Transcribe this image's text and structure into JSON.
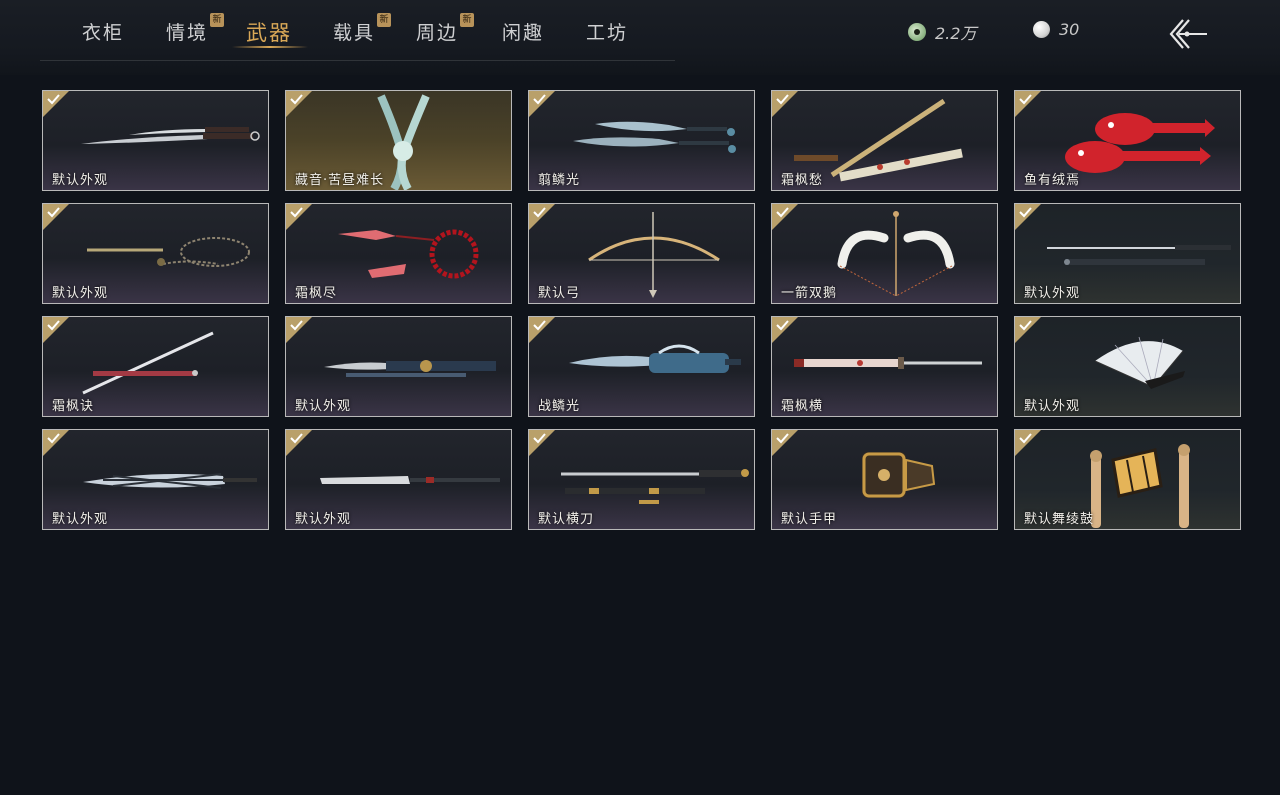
{
  "tabs": [
    {
      "label": "衣柜",
      "new": ""
    },
    {
      "label": "情境",
      "new": "新"
    },
    {
      "label": "武器",
      "new": ""
    },
    {
      "label": "载具",
      "new": "新"
    },
    {
      "label": "周边",
      "new": "新"
    },
    {
      "label": "闲趣",
      "new": ""
    },
    {
      "label": "工坊",
      "new": ""
    }
  ],
  "active_tab": "武器",
  "currency": {
    "jade_amount": "2.2万",
    "pearl_amount": "30"
  },
  "colors": {
    "accent": "#d9a857",
    "check_badge": "#b9a06a",
    "background": "#0f131a"
  },
  "items": [
    {
      "name": "默认外观",
      "icon": "twin-dao-blades"
    },
    {
      "name": "藏音·苦昼难长",
      "icon": "jade-flute-charm"
    },
    {
      "name": "翦鳞光",
      "icon": "twin-dragon-blades"
    },
    {
      "name": "霜枫愁",
      "icon": "flute-and-scabbard"
    },
    {
      "name": "鱼有绒焉",
      "icon": "red-fish-weapons"
    },
    {
      "name": "默认外观",
      "icon": "rope-dart"
    },
    {
      "name": "霜枫尽",
      "icon": "red-rope-dart-beads"
    },
    {
      "name": "默认弓",
      "icon": "bow"
    },
    {
      "name": "一箭双鹅",
      "icon": "white-bow"
    },
    {
      "name": "默认外观",
      "icon": "straight-sword-pair"
    },
    {
      "name": "霜枫诀",
      "icon": "long-sword"
    },
    {
      "name": "默认外观",
      "icon": "blue-dao-scabbard"
    },
    {
      "name": "战鳞光",
      "icon": "ornate-blade"
    },
    {
      "name": "霜枫横",
      "icon": "red-scabbard-sword"
    },
    {
      "name": "默认外观",
      "icon": "folding-fan"
    },
    {
      "name": "默认外观",
      "icon": "umbrella"
    },
    {
      "name": "默认外观",
      "icon": "mo-dao"
    },
    {
      "name": "默认横刀",
      "icon": "heng-dao"
    },
    {
      "name": "默认手甲",
      "icon": "gauntlet"
    },
    {
      "name": "默认舞绫鼓",
      "icon": "dance-drum"
    }
  ]
}
